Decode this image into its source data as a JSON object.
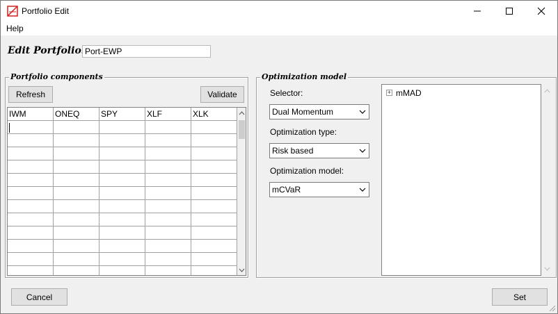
{
  "window": {
    "title": "Portfolio Edit",
    "controls": {
      "minimize": "minimize",
      "maximize": "maximize",
      "close": "close"
    }
  },
  "menu": {
    "help": "Help"
  },
  "edit_portfolio": {
    "label": "Edit Portfolio:",
    "value": "Port-EWP"
  },
  "components": {
    "legend": "Portfolio components",
    "refresh_label": "Refresh",
    "validate_label": "Validate",
    "columns": [
      "IWM",
      "ONEQ",
      "SPY",
      "XLF",
      "XLK"
    ]
  },
  "optimization": {
    "legend": "Optimization model",
    "selector_label": "Selector:",
    "selector_value": "Dual Momentum",
    "type_label": "Optimization type:",
    "type_value": "Risk based",
    "model_label": "Optimization model:",
    "model_value": "mCVaR",
    "tree_items": [
      {
        "label": "mMAD"
      }
    ]
  },
  "footer": {
    "cancel_label": "Cancel",
    "set_label": "Set"
  },
  "colors": {
    "title_bar": "#ffffff",
    "dialog_bg": "#f0f0f0",
    "icon_red": "#d11f1f"
  }
}
